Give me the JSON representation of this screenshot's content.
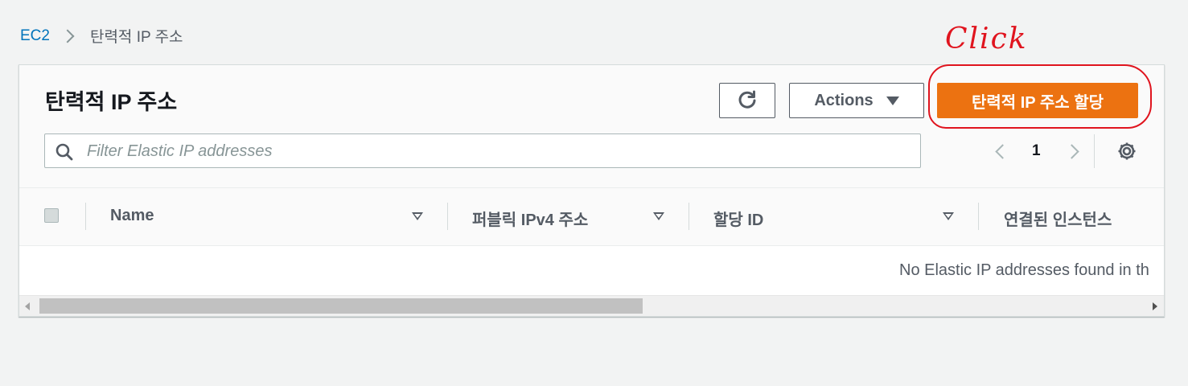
{
  "breadcrumb": {
    "root": "EC2",
    "current": "탄력적 IP 주소"
  },
  "page": {
    "title": "탄력적 IP 주소"
  },
  "toolbar": {
    "actions_label": "Actions",
    "primary_label": "탄력적 IP 주소 할당",
    "refresh_icon": "refresh-icon",
    "primary_color": "#ec7211"
  },
  "annotation": {
    "text": "Click",
    "color": "#e0141e"
  },
  "search": {
    "placeholder": "Filter Elastic IP addresses",
    "value": ""
  },
  "pagination": {
    "current_page": "1"
  },
  "table": {
    "columns": [
      "Name",
      "퍼블릭 IPv4 주소",
      "할당 ID",
      "연결된 인스턴스"
    ],
    "empty_message": "No Elastic IP addresses found in th"
  },
  "colors": {
    "link": "#0073bb",
    "background": "#f2f3f3"
  }
}
